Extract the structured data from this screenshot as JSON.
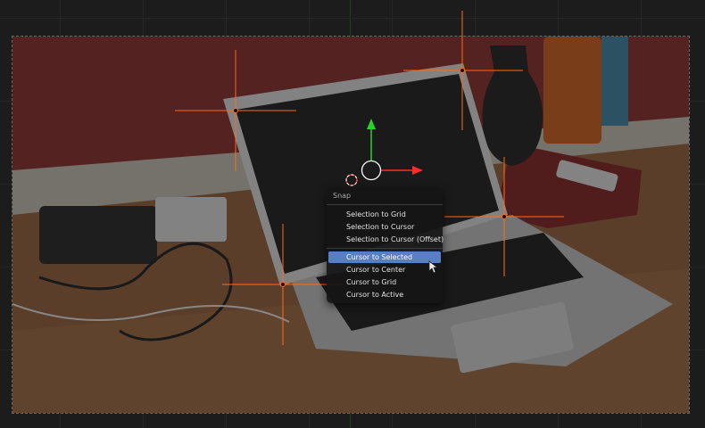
{
  "snap_menu": {
    "title": "Snap",
    "items": [
      {
        "label": "Selection to Grid",
        "active": false
      },
      {
        "label": "Selection to Cursor",
        "active": false
      },
      {
        "label": "Selection to Cursor (Offset)",
        "active": false
      },
      {
        "label": "Cursor to Selected",
        "active": true
      },
      {
        "label": "Cursor to Center",
        "active": false
      },
      {
        "label": "Cursor to Grid",
        "active": false
      },
      {
        "label": "Cursor to Active",
        "active": false
      }
    ]
  },
  "colors": {
    "viewport_bg": "#1c1c1c",
    "grid_line": "#262626",
    "selected_vertex": "#ff7a1a",
    "axis_x": "#ff2a2a",
    "axis_y": "#2ad12a",
    "menu_highlight": "#5680c2"
  }
}
